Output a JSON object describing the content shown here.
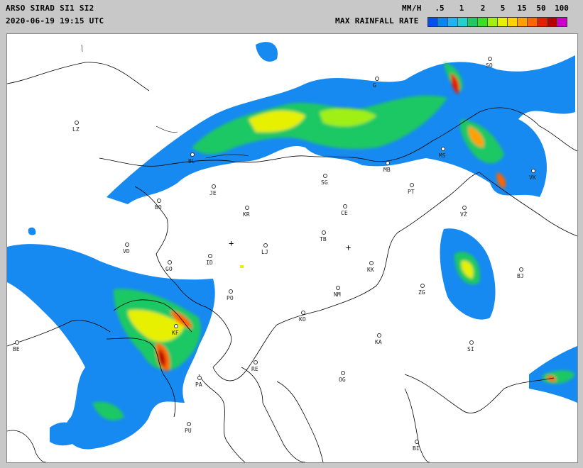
{
  "header": {
    "title": "ARSO SIRAD SI1 SI2",
    "timestamp": "2020-06-19 19:15 UTC",
    "unit": "MM/H",
    "scale_label": "MAX RAINFALL RATE"
  },
  "legend": {
    "ticks": [
      ".5",
      "1",
      "2",
      "5",
      "15",
      "50",
      "100"
    ],
    "colors": [
      "#0050f0",
      "#0a84f0",
      "#1eb4f0",
      "#21d2c8",
      "#1ec864",
      "#3cdc28",
      "#a0f014",
      "#e6f000",
      "#ffd200",
      "#ffa000",
      "#ff6400",
      "#e61e00",
      "#b40000",
      "#c800c8"
    ]
  },
  "map": {
    "cities": [
      {
        "code": "LZ"
      },
      {
        "code": "BL"
      },
      {
        "code": "JE"
      },
      {
        "code": "BO"
      },
      {
        "code": "KR"
      },
      {
        "code": "SG"
      },
      {
        "code": "MB"
      },
      {
        "code": "PT"
      },
      {
        "code": "MS"
      },
      {
        "code": "VK"
      },
      {
        "code": "VŽ"
      },
      {
        "code": "CE"
      },
      {
        "code": "TB"
      },
      {
        "code": "LJ"
      },
      {
        "code": "VD"
      },
      {
        "code": "GO"
      },
      {
        "code": "ID"
      },
      {
        "code": "KK"
      },
      {
        "code": "BJ"
      },
      {
        "code": "NM"
      },
      {
        "code": "ZG"
      },
      {
        "code": "PO"
      },
      {
        "code": "KO"
      },
      {
        "code": "KF"
      },
      {
        "code": "KA"
      },
      {
        "code": "SI"
      },
      {
        "code": "BE"
      },
      {
        "code": "RE"
      },
      {
        "code": "OG"
      },
      {
        "code": "PA"
      },
      {
        "code": "PU"
      },
      {
        "code": "BI"
      },
      {
        "code": "SO"
      },
      {
        "code": "G"
      }
    ],
    "radar_markers": [
      "radar-site-si1",
      "radar-site-si2"
    ]
  }
}
